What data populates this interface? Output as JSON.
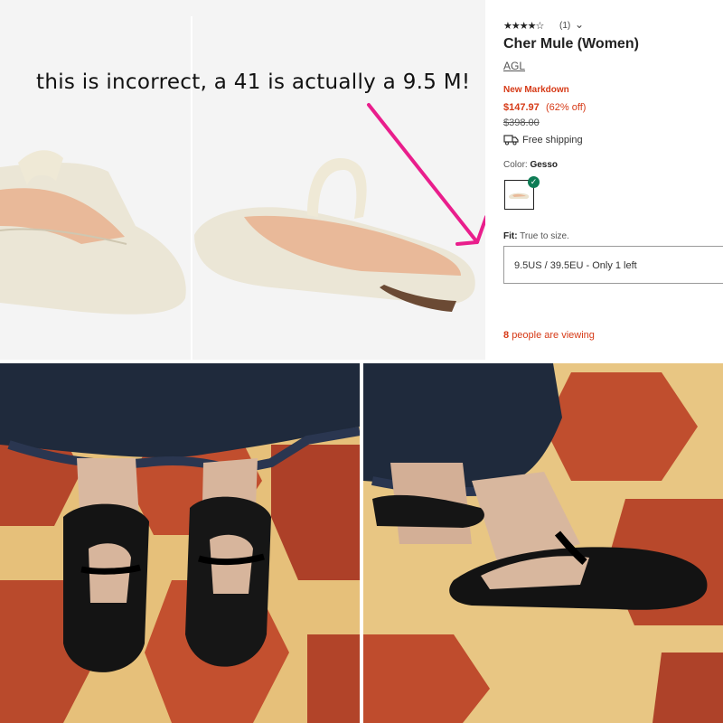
{
  "annotation": {
    "text": "this is incorrect, a 41 is actually a 9.5 M!",
    "arrow_color": "#e91e8c"
  },
  "product": {
    "rating_stars": "★★★★☆",
    "rating_count": "(1)",
    "chevron": "⌄",
    "title": "Cher Mule (Women)",
    "brand": "AGL",
    "markdown_label": "New Markdown",
    "sale_price": "$147.97",
    "discount": "(62% off)",
    "original_price": "$398.00",
    "shipping": "Free shipping",
    "color_label": "Color:",
    "color_value": "Gesso",
    "fit_label": "Fit:",
    "fit_value": "True to size.",
    "size_selected": "9.5US / 39.5EU - Only 1 left",
    "viewers_count": "8",
    "viewers_text": "people are viewing",
    "sale_color": "#d63a17",
    "check_color": "#0e7c55"
  },
  "icons": {
    "truck": "truck-icon",
    "check": "check-icon"
  }
}
